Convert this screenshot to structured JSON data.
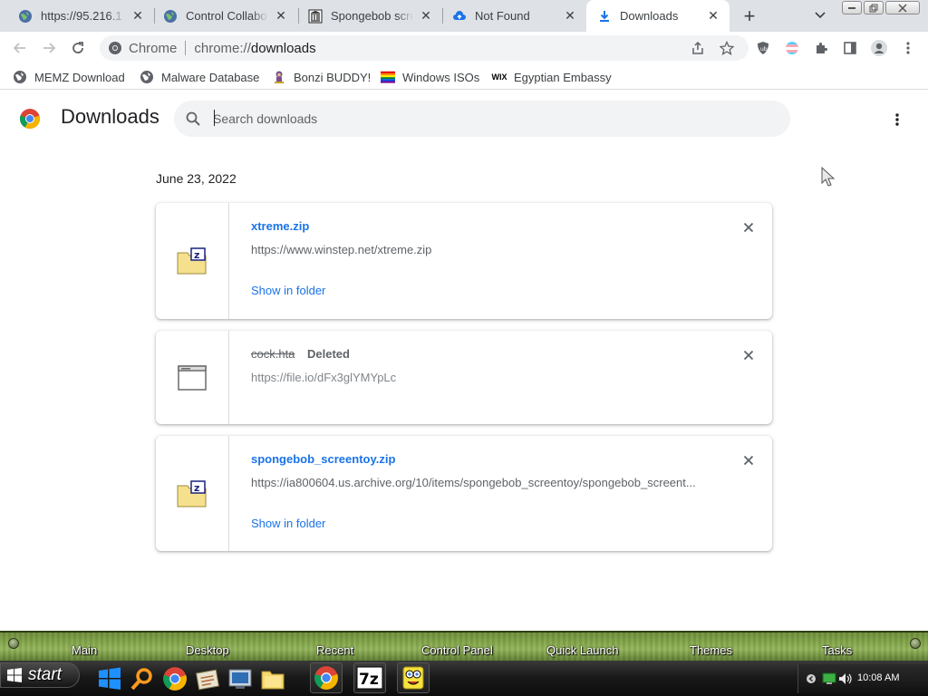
{
  "colors": {
    "accent": "#1a73e8",
    "tab_strip": "#dee1e6",
    "muted": "#5f6368"
  },
  "tabs": [
    {
      "title": "https://95.216.1",
      "icon": "globe-icon",
      "active": false
    },
    {
      "title": "Control Collabo",
      "icon": "globe-icon",
      "active": false
    },
    {
      "title": "Spongebob scre",
      "icon": "museum-icon",
      "active": false
    },
    {
      "title": "Not Found",
      "icon": "cloud-upload-icon",
      "active": false
    },
    {
      "title": "Downloads",
      "icon": "download-icon",
      "active": true
    }
  ],
  "omnibox": {
    "site_label": "Chrome",
    "url_scheme": "chrome://",
    "url_host": "downloads"
  },
  "bookmarks": [
    {
      "label": "MEMZ Download",
      "icon": "globe-icon"
    },
    {
      "label": "Malware Database",
      "icon": "globe-icon"
    },
    {
      "label": "Bonzi BUDDY!",
      "icon": "bonzi-icon"
    },
    {
      "label": "Windows ISOs",
      "icon": "rainbow-flag-icon"
    },
    {
      "label": "Egyptian Embassy",
      "icon": "wix-icon"
    }
  ],
  "downloads_page": {
    "title": "Downloads",
    "search_placeholder": "Search downloads",
    "date_group": "June 23, 2022",
    "items": [
      {
        "file_name": "xtreme.zip",
        "url": "https://www.winstep.net/xtreme.zip",
        "status": "",
        "action": "Show in folder",
        "deleted": false,
        "icon": "zip-folder-icon"
      },
      {
        "file_name": "cock.hta",
        "url": "https://file.io/dFx3glYMYpLc",
        "status": "Deleted",
        "action": "",
        "deleted": true,
        "icon": "window-file-icon"
      },
      {
        "file_name": "spongebob_screentoy.zip",
        "url": "https://ia800604.us.archive.org/10/items/spongebob_screentoy/spongebob_screent...",
        "status": "",
        "action": "Show in folder",
        "deleted": false,
        "icon": "zip-folder-icon"
      }
    ]
  },
  "launcher": {
    "items": [
      "Main",
      "Desktop",
      "Recent",
      "Control Panel",
      "Quick Launch",
      "Themes",
      "Tasks"
    ]
  },
  "taskbar": {
    "start_label": "start",
    "quick_launch": [
      "windows-logo-icon",
      "search-icon",
      "chrome-icon",
      "notepad-icon",
      "computer-icon",
      "folder-icon"
    ],
    "tasks": [
      "chrome-icon",
      "7zip-icon",
      "spongebob-icon"
    ],
    "clock": "10:08 AM"
  }
}
